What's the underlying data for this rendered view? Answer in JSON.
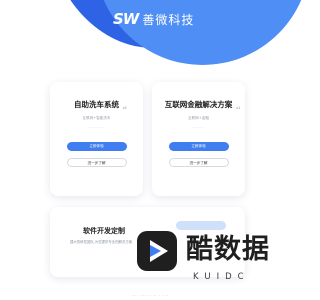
{
  "header": {
    "logo_mark": "SW",
    "brand_name": "善微科技"
  },
  "cards": [
    {
      "title": "自助洗车系统",
      "version": "v1",
      "subtitle": "互联网+智能洗车",
      "tagline": "·· ·· ·· ·· ··",
      "primary_label": "立即体验",
      "secondary_label": "进一步了解"
    },
    {
      "title": "互联网金融解决方案",
      "version": "v1",
      "subtitle": "互联网+金融",
      "tagline": "·· ·· ·· ··",
      "primary_label": "立即体验",
      "secondary_label": "进一步了解"
    }
  ],
  "custom_dev": {
    "title": "软件开发定制",
    "description": "建大的研发团队,为您提供专业的解决方案"
  },
  "watermark": {
    "text": "酷数据",
    "sub": "KUIDC"
  },
  "footer": {
    "text": "···· · ···· ·· ···· ·· ·····"
  },
  "colors": {
    "brand_blue": "#3f7df0",
    "header_dark": "#2f63e6",
    "header_light": "#4f8ff5"
  }
}
